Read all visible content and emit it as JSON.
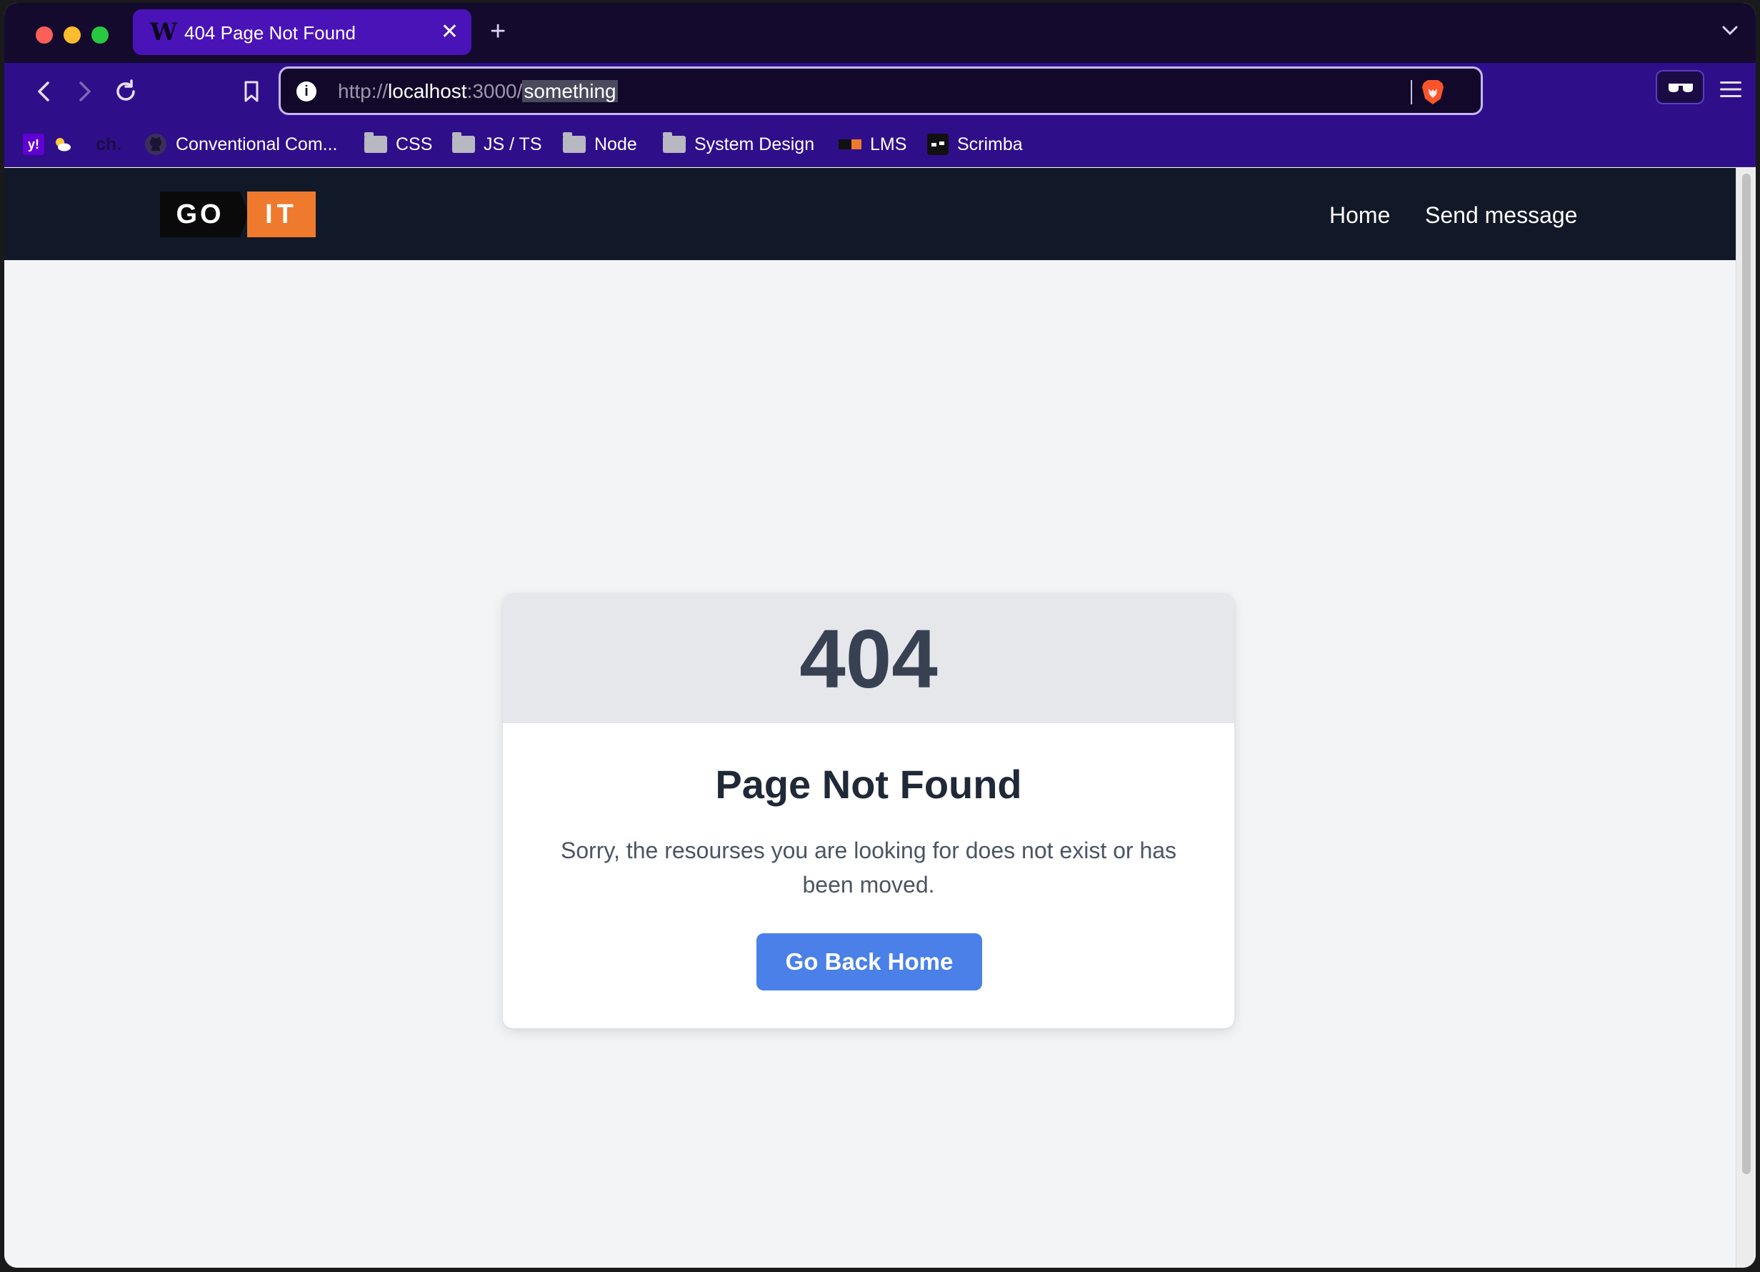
{
  "browser": {
    "tab": {
      "title": "404 Page Not Found",
      "favicon_letter": "W",
      "close": "✕"
    },
    "new_tab": "+",
    "url": {
      "scheme": "http://",
      "host": "localhost",
      "port": ":3000/",
      "path": "something"
    },
    "bookmarks": [
      {
        "label": "Conventional Com...",
        "icon": "github-icon"
      },
      {
        "label": "CSS",
        "icon": "folder-icon"
      },
      {
        "label": "JS / TS",
        "icon": "folder-icon"
      },
      {
        "label": "Node",
        "icon": "folder-icon"
      },
      {
        "label": "System Design",
        "icon": "folder-icon"
      },
      {
        "label": "LMS",
        "icon": "goit-icon"
      },
      {
        "label": "Scrimba",
        "icon": "scrimba-icon"
      }
    ],
    "bookmark_misc": {
      "yahoo": "y!",
      "ch": "ch."
    },
    "colors": {
      "tab_bar": "#140a2e",
      "toolbar": "#2f0e8a",
      "active_tab": "#4a13b8"
    }
  },
  "site": {
    "logo": {
      "left": "GO",
      "right": "IT"
    },
    "nav": {
      "home": "Home",
      "send_message": "Send message"
    }
  },
  "error_card": {
    "code": "404",
    "title": "Page Not Found",
    "message": "Sorry, the resourses you are looking for does not exist or has been moved.",
    "button": "Go Back Home"
  },
  "colors": {
    "header_bg": "#111827",
    "button_bg": "#4a80e8",
    "logo_accent": "#ef7a2d"
  }
}
